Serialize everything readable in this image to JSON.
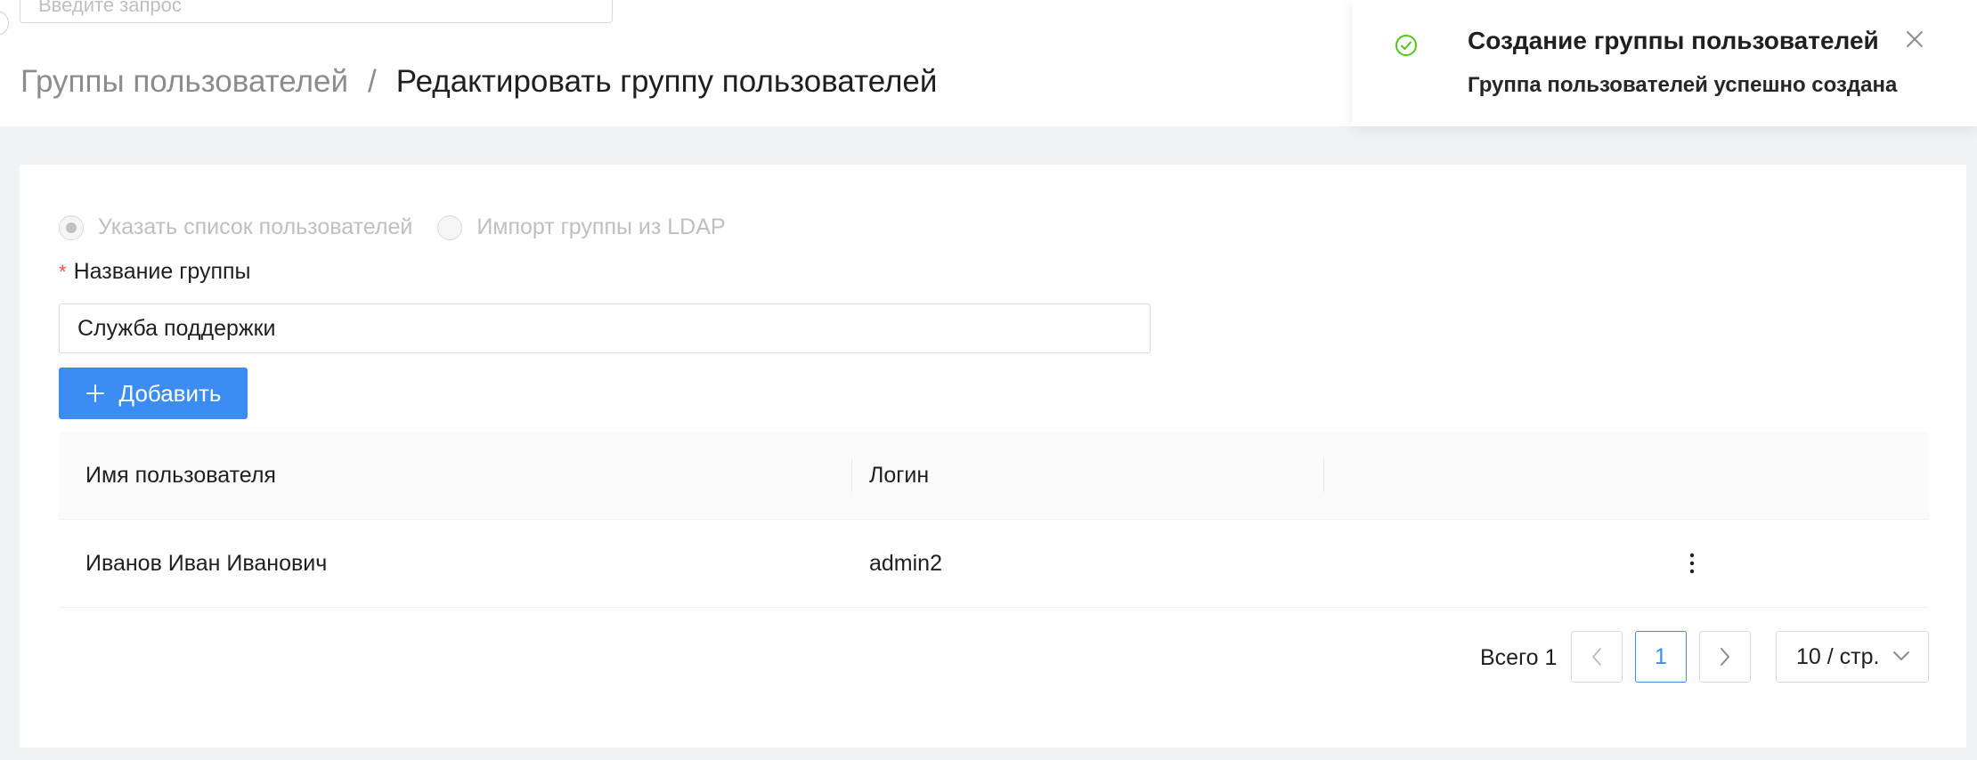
{
  "search": {
    "placeholder": "Введите запрос",
    "value": ""
  },
  "breadcrumb": {
    "parent": "Группы пользователей",
    "separator": "/",
    "current": "Редактировать группу пользователей"
  },
  "notification": {
    "title": "Создание группы пользователей",
    "description": "Группа пользователей успешно создана",
    "icon": "check-circle-icon",
    "icon_color": "#52c41a"
  },
  "form": {
    "radio_options": [
      {
        "label": "Указать список пользователей",
        "checked": true
      },
      {
        "label": "Импорт группы из LDAP",
        "checked": false
      }
    ],
    "required_mark": "*",
    "group_name_label": "Название группы",
    "group_name_value": "Служба поддержки",
    "add_button_label": "Добавить"
  },
  "table": {
    "columns": [
      "Имя пользователя",
      "Логин",
      ""
    ],
    "rows": [
      {
        "name": "Иванов Иван Иванович",
        "login": "admin2"
      }
    ]
  },
  "pagination": {
    "total_label": "Всего 1",
    "current_page": "1",
    "page_size_label": "10 / стр."
  },
  "colors": {
    "primary": "#3b8df3",
    "success": "#52c41a",
    "required": "#ff4d4f",
    "background": "#f0f2f5"
  }
}
